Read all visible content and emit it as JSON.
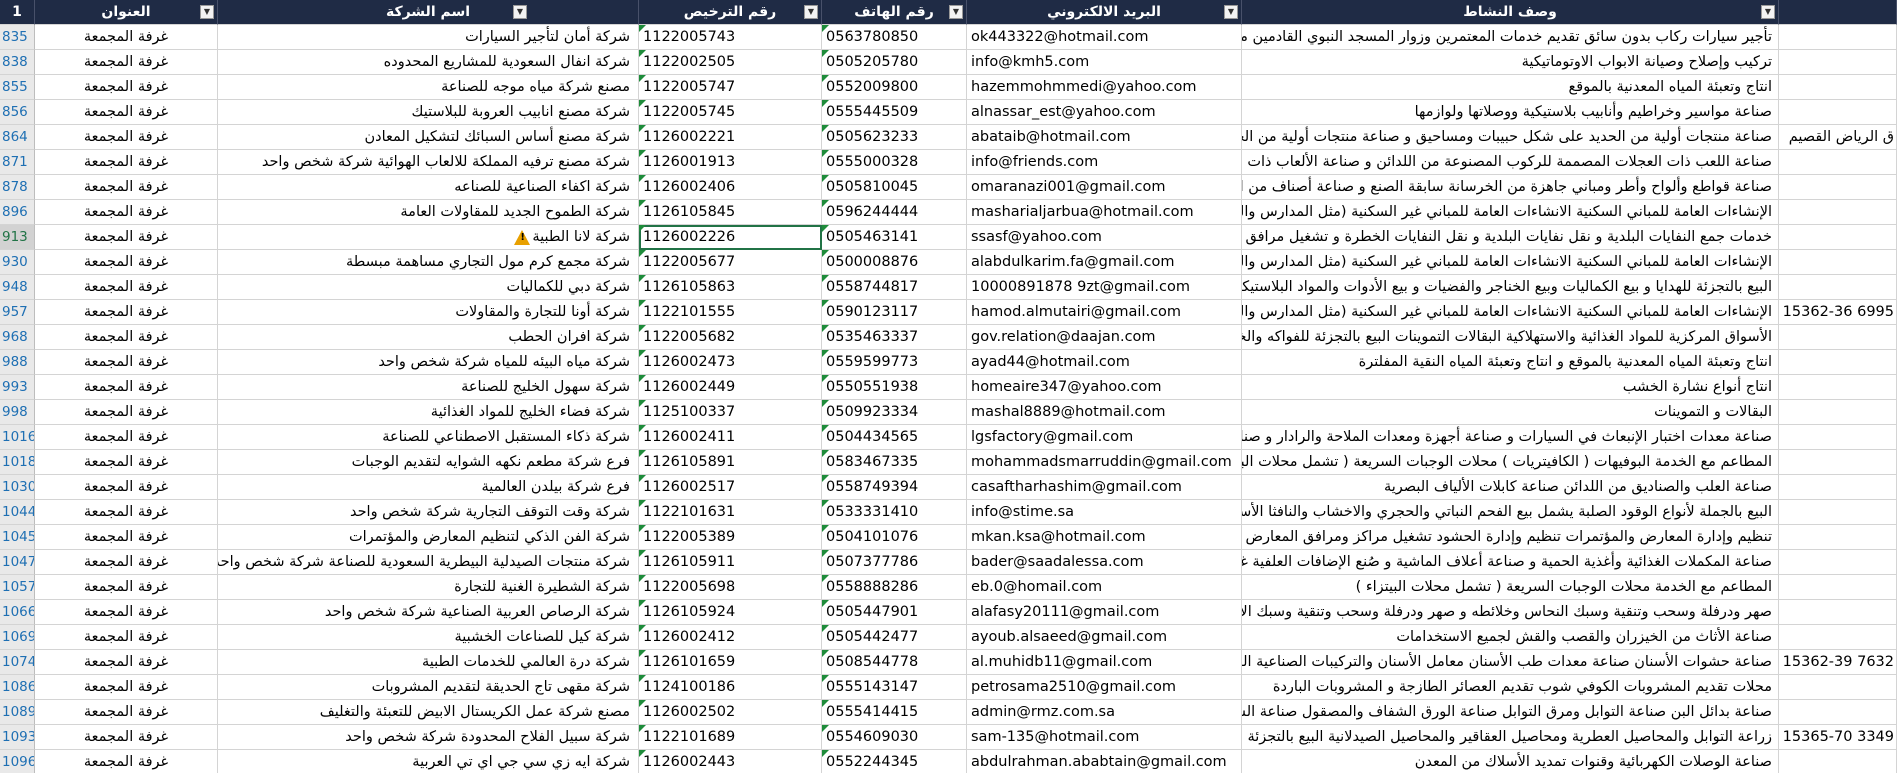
{
  "header": {
    "row_num": "1",
    "col_address": "العنوان",
    "col_company": "اسم الشركة",
    "col_license": "رقم الترخيص",
    "col_phone": "رقم الهاتف",
    "col_email": "البريد الالكتروني",
    "col_activity": "وصف النشاط"
  },
  "rows": [
    {
      "n": "835",
      "addr": "غرفة المجمعة",
      "company": "شركة أمان لتأجير السيارات",
      "lic": "1122005743",
      "tel": "0563780850",
      "email": "ok443322@hotmail.com",
      "act": "تأجير سيارات ركاب بدون سائق تقديم خدمات المعتمرين وزوار المسجد النبوي القادمين من خارج",
      "ext": ""
    },
    {
      "n": "838",
      "addr": "غرفة المجمعة",
      "company": "شركة انفال السعودية للمشاريع المحدوده",
      "lic": "1122002505",
      "tel": "0505205780",
      "email": "info@kmh5.com",
      "act": "تركيب وإصلاح وصيانة الابواب الاوتوماتيكية",
      "ext": ""
    },
    {
      "n": "855",
      "addr": "غرفة المجمعة",
      "company": "مصنع شركة مياه موجه للصناعة",
      "lic": "1122005747",
      "tel": "0552009800",
      "email": "hazemmohmmedi@yahoo.com",
      "act": "انتاج وتعبئة المياه المعدنية بالموقع",
      "ext": ""
    },
    {
      "n": "856",
      "addr": "غرفة المجمعة",
      "company": "شركة مصنع انابيب العروبة للبلاستيك",
      "lic": "1122005745",
      "tel": "0555445509",
      "email": "alnassar_est@yahoo.com",
      "act": "صناعة مواسير وخراطيم وأنابيب بلاستيكية ووصلاتها ولوازمها",
      "ext": ""
    },
    {
      "n": "864",
      "addr": "غرفة المجمعة",
      "company": "شركة مصنع أساس السبائك لتشكيل المعادن",
      "lic": "1126002221",
      "tel": "0505623233",
      "email": "abataib@hotmail.com",
      "act": "صناعة منتجات أولية من الحديد على شكل حبيبات ومساحيق و صناعة منتجات أولية من الحديد",
      "ext": "ق الرياض القصيم"
    },
    {
      "n": "871",
      "addr": "غرفة المجمعة",
      "company": "شركة مصنع ترفيه المملكة للالعاب الهوائية شركة شخص واحد",
      "lic": "1126001913",
      "tel": "0555000328",
      "email": "info@friends.com",
      "act": "صناعة اللعب ذات العجلات المصممة للركوب المصنوعة من اللدائن و صناعة الألعاب ذات الرقع",
      "ext": ""
    },
    {
      "n": "878",
      "addr": "غرفة المجمعة",
      "company": "شركة اكفاء الصناعية للصناعه",
      "lic": "1126002406",
      "tel": "0505810045",
      "email": "omaranazi001@gmail.com",
      "act": "صناعة قواطع وألواح وأطر ومباني جاهزة من الخرسانة سابقة الصنع و صناعة أصناف من الأسمنت",
      "ext": ""
    },
    {
      "n": "896",
      "addr": "غرفة المجمعة",
      "company": "شركة الطموح الجديد للمقاولات العامة",
      "lic": "1126105845",
      "tel": "0596244444",
      "email": "masharialjarbua@hotmail.com",
      "act": "الإنشاءات العامة للمباني السكنية الانشاءات العامة للمباني غير السكنية (مثل المدارس والمستشفيات",
      "ext": ""
    },
    {
      "n": "913",
      "addr": "غرفة المجمعة",
      "company": "شركة لانا الطبية",
      "lic": "1126002226",
      "tel": "0505463141",
      "email": "ssasf@yahoo.com",
      "act": "خدمات جمع النفايات البلدية و نقل نفايات البلدية و نقل النفايات الخطرة و تشغيل مرافق معالج",
      "ext": ""
    },
    {
      "n": "930",
      "addr": "غرفة المجمعة",
      "company": "شركة مجمع كرم مول التجاري مساهمة مبسطة",
      "lic": "1122005677",
      "tel": "0500008876",
      "email": "alabdulkarim.fa@gmail.com",
      "act": "الإنشاءات العامة للمباني السكنية الانشاءات العامة للمباني غير السكنية (مثل المدارس والمستشفيات",
      "ext": ""
    },
    {
      "n": "948",
      "addr": "غرفة المجمعة",
      "company": "شركة دبي للكماليات",
      "lic": "1126105863",
      "tel": "0558744817",
      "email": "10000891878 9zt@gmail.com",
      "act": "البيع بالتجزئة للهدايا و بيع الكماليات وبيع الخناجر والفضيات و بيع الأدوات والمواد البلاستيكية ب",
      "ext": ""
    },
    {
      "n": "957",
      "addr": "غرفة المجمعة",
      "company": "شركة أونا للتجارة والمقاولات",
      "lic": "1122101555",
      "tel": "0590123117",
      "email": "hamod.almutairi@gmail.com",
      "act": "الإنشاءات العامة للمباني السكنية الانشاءات العامة للمباني غير السكنية (مثل المدارس والمستشفيات",
      "ext": "6995 15362-36"
    },
    {
      "n": "968",
      "addr": "غرفة المجمعة",
      "company": "شركة افران الحطب",
      "lic": "1122005682",
      "tel": "0535463337",
      "email": "gov.relation@daajan.com",
      "act": "الأسواق المركزية للمواد الغذائية والاستهلاكية البقالات التموينات البيع بالتجزئة للفواكه والخضروا",
      "ext": ""
    },
    {
      "n": "988",
      "addr": "غرفة المجمعة",
      "company": "شركة مياه البيئه للمياه شركة شخص واحد",
      "lic": "1126002473",
      "tel": "0559599773",
      "email": "ayad44@hotmail.com",
      "act": "انتاج وتعبئة المياه المعدنية بالموقع و انتاج وتعبئة المياه النقية المفلترة",
      "ext": ""
    },
    {
      "n": "993",
      "addr": "غرفة المجمعة",
      "company": "شركة سهول الخليج للصناعة",
      "lic": "1126002449",
      "tel": "0550551938",
      "email": "homeaire347@yahoo.com",
      "act": "انتاج أنواع نشارة الخشب",
      "ext": ""
    },
    {
      "n": "998",
      "addr": "غرفة المجمعة",
      "company": "شركة فضاء الخليج للمواد الغذائية",
      "lic": "1125100337",
      "tel": "0509923334",
      "email": "mashal8889@hotmail.com",
      "act": "البقالات و التموينات",
      "ext": ""
    },
    {
      "n": "1016",
      "addr": "غرفة المجمعة",
      "company": "شركة ذكاء المستقبل الاصطناعي للصناعة",
      "lic": "1126002411",
      "tel": "0504434565",
      "email": "lgsfactory@gmail.com",
      "act": "صناعة معدات اختبار الإنبعاث في السيارات و صناعة أجهزة ومعدات الملاحة والرادار و صناعة عد",
      "ext": ""
    },
    {
      "n": "1018",
      "addr": "غرفة المجمعة",
      "company": "فرع شركة مطعم نكهه الشوايه لتقديم الوجبات",
      "lic": "1126105891",
      "tel": "0583467335",
      "email": "mohammadsmarruddin@gmail.com",
      "act": "المطاعم مع الخدمة البوفيهات ( الكافيتريات ) محلات الوجبات السريعة ( تشمل محلات البيتزاء )",
      "ext": ""
    },
    {
      "n": "1030",
      "addr": "غرفة المجمعة",
      "company": "فرع شركة بيلدن العالمية",
      "lic": "1126002517",
      "tel": "0558749394",
      "email": "casaftharhashim@gmail.com",
      "act": "صناعة العلب والصناديق من اللدائن صناعة كابلات الألياف البصرية",
      "ext": ""
    },
    {
      "n": "1044",
      "addr": "غرفة المجمعة",
      "company": "شركة وقت التوقف التجارية شركة شخص واحد",
      "lic": "1122101631",
      "tel": "0533331410",
      "email": "info@stime.sa",
      "act": "البيع بالجملة لأنواع الوقود الصلبة يشمل بيع الفحم النباتي والحجري والاخشاب والنافثا الأسواق",
      "ext": ""
    },
    {
      "n": "1045",
      "addr": "غرفة المجمعة",
      "company": "شركة الفن الذكي لتنظيم المعارض والمؤتمرات",
      "lic": "1122005389",
      "tel": "0504101076",
      "email": "mkan.ksa@hotmail.com",
      "act": "تنظيم وإدارة المعارض والمؤتمرات تنظيم وإدارة الحشود تشغيل مراكز ومرافق المعارض والمؤتمرا",
      "ext": ""
    },
    {
      "n": "1047",
      "addr": "غرفة المجمعة",
      "company": "شركة منتجات الصيدلية البيطرية السعودية للصناعة شركة شخص واحد",
      "lic": "1126105911",
      "tel": "0507377786",
      "email": "bader@saadalessa.com",
      "act": "صناعة المكملات الغذائية وأغذية الحمية و صناعة أعلاف الماشية و صُنع الإضافات العلفية غير ال",
      "ext": ""
    },
    {
      "n": "1057",
      "addr": "غرفة المجمعة",
      "company": "شركة الشطيرة الغنية للتجارة",
      "lic": "1122005698",
      "tel": "0558888286",
      "email": "eb.0@homail.com",
      "act": "المطاعم مع الخدمة محلات الوجبات السريعة ( تشمل محلات البيتزاء )",
      "ext": ""
    },
    {
      "n": "1066",
      "addr": "غرفة المجمعة",
      "company": "شركة الرصاص العربية الصناعية شركة شخص واحد",
      "lic": "1126105924",
      "tel": "0505447901",
      "email": "alafasy20111@gmail.com",
      "act": "صهر ودرفلة وسحب وتنقية وسبك النحاس وخلائطه و صهر ودرفلة وسحب وتنقية وسبك الألمني",
      "ext": ""
    },
    {
      "n": "1069",
      "addr": "غرفة المجمعة",
      "company": "شركة كيل للصناعات الخشبية",
      "lic": "1126002412",
      "tel": "0505442477",
      "email": "ayoub.alsaeed@gmail.com",
      "act": "صناعة الأثاث من الخيزران والقصب والقش لجميع الاستخدامات",
      "ext": ""
    },
    {
      "n": "1074",
      "addr": "غرفة المجمعة",
      "company": "شركة درة العالمي للخدمات الطبية",
      "lic": "1126101659",
      "tel": "0508544778",
      "email": "al.muhidb11@gmail.com",
      "act": "صناعة حشوات الأسنان صناعة معدات طب الأسنان معامل الأسنان والتركيبات الصناعية المجمع",
      "ext": "7632 15362-39"
    },
    {
      "n": "1086",
      "addr": "غرفة المجمعة",
      "company": "شركة مقهى تاج الحديقة لتقديم المشروبات",
      "lic": "1124100186",
      "tel": "0555143147",
      "email": "petrosama2510@gmail.com",
      "act": "محلات تقديم المشروبات الكوفي شوب تقديم العصائر الطازجة و المشروبات الباردة",
      "ext": ""
    },
    {
      "n": "1089",
      "addr": "غرفة المجمعة",
      "company": "مصنع شركة عمل الكريستال الابيض للتعبئة والتغليف",
      "lic": "1126002502",
      "tel": "0555414415",
      "email": "admin@rmz.com.sa",
      "act": "صناعة بدائل البن صناعة التوابل ومرق التوابل صناعة الورق الشفاف والمصقول صناعة السكر الك",
      "ext": ""
    },
    {
      "n": "1093",
      "addr": "غرفة المجمعة",
      "company": "شركة سبيل الفلاح المحدودة شركة شخص واحد",
      "lic": "1122101689",
      "tel": "0554609030",
      "email": "sam-135@hotmail.com",
      "act": "زراعة التوابل والمحاصيل العطرية ومحاصيل العقاقير والمحاصيل الصيدلانية البيع بالتجزئة لمستـ",
      "ext": "3349 15365-70"
    },
    {
      "n": "1096",
      "addr": "غرفة المجمعة",
      "company": "شركة ايه زي سي جي اي تي العربية",
      "lic": "1126002443",
      "tel": "0552244345",
      "email": "abdulrahman.ababtain@gmail.com",
      "act": "صناعة الوصلات الكهربائية وقنوات تمديد الأسلاك من المعدن",
      "ext": ""
    }
  ]
}
